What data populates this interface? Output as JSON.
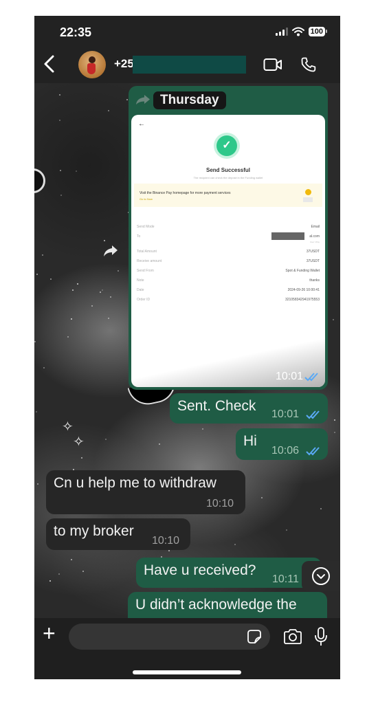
{
  "status_bar": {
    "time": "22:35",
    "battery": "100"
  },
  "header": {
    "back_icon": "chevron-left-icon",
    "contact_name": "+25",
    "contact_redacted": true,
    "video_call_icon": "video-camera-icon",
    "voice_call_icon": "phone-icon"
  },
  "chat": {
    "date_separator": "Thursday",
    "image_message": {
      "direction": "outgoing",
      "time": "10:01",
      "read": true,
      "screenshot": {
        "title": "Send Successful",
        "subtitle": "The recipient can check the deposit in the Funding wallet",
        "banner_text": "Visit the Binance Pay homepage for more payment services",
        "banner_link": "Go to Now",
        "details": [
          {
            "label": "Send Mode",
            "value": "Email"
          },
          {
            "label": "To",
            "value": "al.com",
            "note": "User 1Pay",
            "redacted": true
          },
          {
            "label": "Total Amount",
            "value": "37USDT"
          },
          {
            "label": "Receive amount",
            "value": "37USDT"
          },
          {
            "label": "Send From",
            "value": "Spot & Funding Wallet"
          },
          {
            "label": "Note",
            "value": "thanks"
          },
          {
            "label": "Date",
            "value": "2024-09-26 10:00:41"
          },
          {
            "label": "Order ID",
            "value": "321058342941975553"
          }
        ]
      }
    },
    "messages": [
      {
        "direction": "outgoing",
        "text": "Sent. Check",
        "time": "10:01",
        "read": true
      },
      {
        "direction": "outgoing",
        "text": "Hi",
        "time": "10:06",
        "read": true
      },
      {
        "direction": "incoming",
        "text": "Cn u help me to withdraw",
        "time": "10:10"
      },
      {
        "direction": "incoming",
        "text": "to my broker",
        "time": "10:10"
      },
      {
        "direction": "outgoing",
        "text": "Have u received?",
        "time": "10:11",
        "read": false
      },
      {
        "direction": "outgoing",
        "text": "U didn’t acknowledge the",
        "time": "",
        "read": false
      }
    ],
    "scroll_down_icon": "chevron-down-circle-icon",
    "colors": {
      "outgoing_bubble": "#1f5c45",
      "incoming_bubble": "#262626",
      "read_ticks": "#5aa9f5"
    }
  },
  "input_bar": {
    "plus_icon": "plus-icon",
    "message_value": "",
    "sticker_icon": "sticker-icon",
    "camera_icon": "camera-icon",
    "mic_icon": "microphone-icon"
  }
}
